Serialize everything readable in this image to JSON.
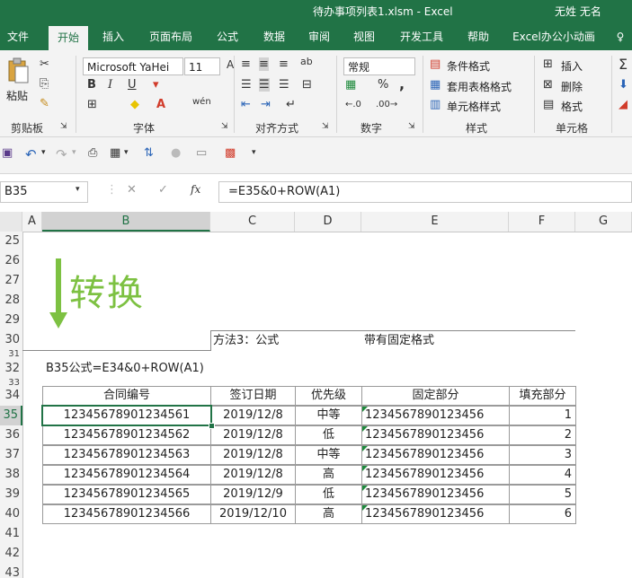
{
  "window": {
    "title": "待办事项列表1.xlsm  -  Excel",
    "user": "无姓 无名"
  },
  "tabs": [
    "文件",
    "开始",
    "插入",
    "页面布局",
    "公式",
    "数据",
    "审阅",
    "视图",
    "开发工具",
    "帮助",
    "Excel办公小动画"
  ],
  "active_tab": "开始",
  "ribbon": {
    "clipboard": {
      "paste": "粘贴",
      "label": "剪贴板"
    },
    "font": {
      "family": "Microsoft YaHei",
      "size": "11",
      "label": "字体",
      "bold": "B",
      "italic": "I",
      "underline": "U",
      "phonetic": "wén"
    },
    "alignment": {
      "label": "对齐方式"
    },
    "number": {
      "format": "常规",
      "label": "数字",
      "percent": "%",
      "comma": ","
    },
    "styles": {
      "conditional": "条件格式",
      "table": "套用表格格式",
      "cell": "单元格样式",
      "label": "样式"
    },
    "cells": {
      "insert": "插入",
      "delete": "删除",
      "format": "格式",
      "label": "单元格"
    }
  },
  "formula_bar": {
    "name_box": "B35",
    "formula": "=E35&0+ROW(A1)",
    "fx": "fx"
  },
  "columns": [
    "A",
    "B",
    "C",
    "D",
    "E",
    "F",
    "G"
  ],
  "rows": [
    "25",
    "26",
    "27",
    "28",
    "29",
    "30",
    "31",
    "32",
    "33",
    "34",
    "35",
    "36",
    "37",
    "38",
    "39",
    "40",
    "41",
    "42",
    "43"
  ],
  "selected_cell": {
    "col": "B",
    "row": "35"
  },
  "sheet": {
    "arrow_text": "转换",
    "method_label": "方法3：公式",
    "method_note": "带有固定格式",
    "formula_note": "B35公式=E34&0+ROW(A1)",
    "table": {
      "headers": [
        "合同编号",
        "签订日期",
        "优先级",
        "固定部分",
        "填充部分"
      ],
      "rows": [
        [
          "12345678901234561",
          "2019/12/8",
          "中等",
          "1234567890123456",
          "1"
        ],
        [
          "12345678901234562",
          "2019/12/8",
          "低",
          "1234567890123456",
          "2"
        ],
        [
          "12345678901234563",
          "2019/12/8",
          "中等",
          "1234567890123456",
          "3"
        ],
        [
          "12345678901234564",
          "2019/12/8",
          "高",
          "1234567890123456",
          "4"
        ],
        [
          "12345678901234565",
          "2019/12/9",
          "低",
          "1234567890123456",
          "5"
        ],
        [
          "12345678901234566",
          "2019/12/10",
          "高",
          "1234567890123456",
          "6"
        ]
      ]
    }
  },
  "colors": {
    "excel_green": "#217346",
    "arrow_green": "#7dc142",
    "selection": "#217346"
  }
}
